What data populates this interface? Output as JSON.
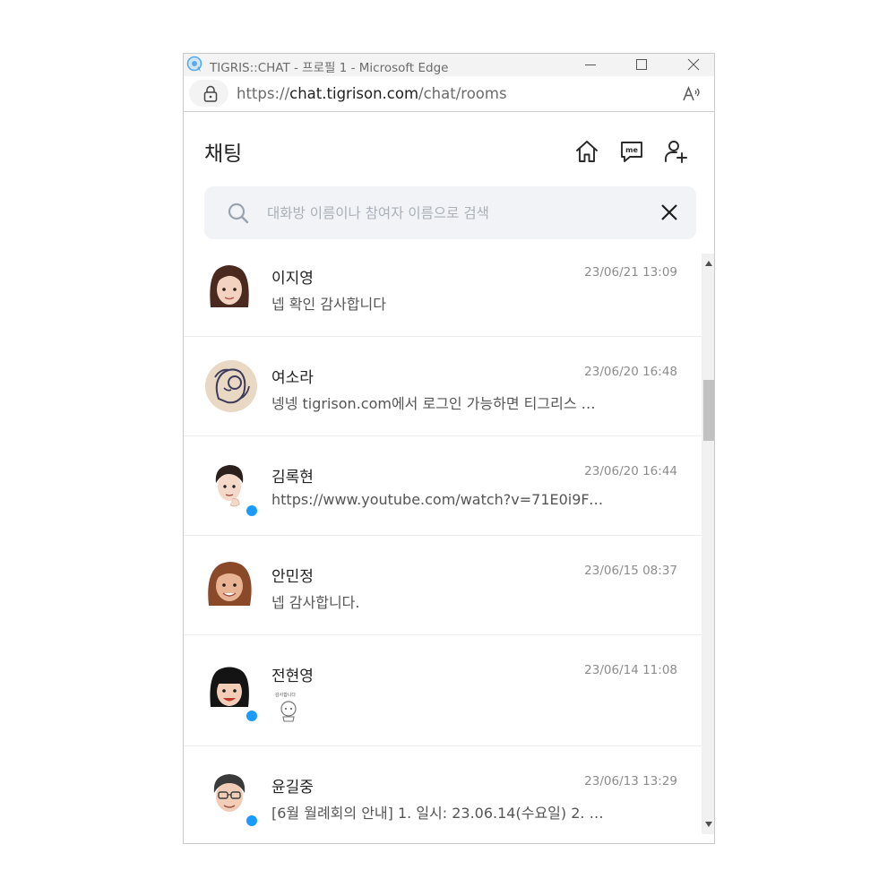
{
  "window": {
    "title": "TIGRIS::CHAT - 프로필 1 - Microsoft Edge",
    "url_scheme": "https://",
    "url_host": "chat.tigrison.com",
    "url_path": "/chat/rooms"
  },
  "header": {
    "title": "채팅"
  },
  "search": {
    "placeholder": "대화방 이름이나 참여자 이름으로 검색",
    "value": ""
  },
  "rooms": [
    {
      "name": "이지영",
      "time": "23/06/21 13:09",
      "message": "넵 확인 감사합니다",
      "online": false
    },
    {
      "name": "여소라",
      "time": "23/06/20 16:48",
      "message": "넹넹 tigrison.com에서 로그인 가능하면 티그리스 앱…",
      "online": false
    },
    {
      "name": "김록현",
      "time": "23/06/20 16:44",
      "message": "https://www.youtube.com/watch?v=71E0i9Fo…",
      "online": true
    },
    {
      "name": "안민정",
      "time": "23/06/15 08:37",
      "message": "넵 감사합니다.",
      "online": false
    },
    {
      "name": "전현영",
      "time": "23/06/14 11:08",
      "message": "",
      "sticker_text": "감사합니다",
      "online": true
    },
    {
      "name": "윤길중",
      "time": "23/06/13 13:29",
      "message": "[6월 월례회의 안내] 1. 일시: 23.06.14(수요일) 2. 시…",
      "online": true
    }
  ],
  "colors": {
    "online_dot": "#1a9bff",
    "search_bg": "#f1f3f7",
    "accent_icon": "#2a2a2a"
  }
}
